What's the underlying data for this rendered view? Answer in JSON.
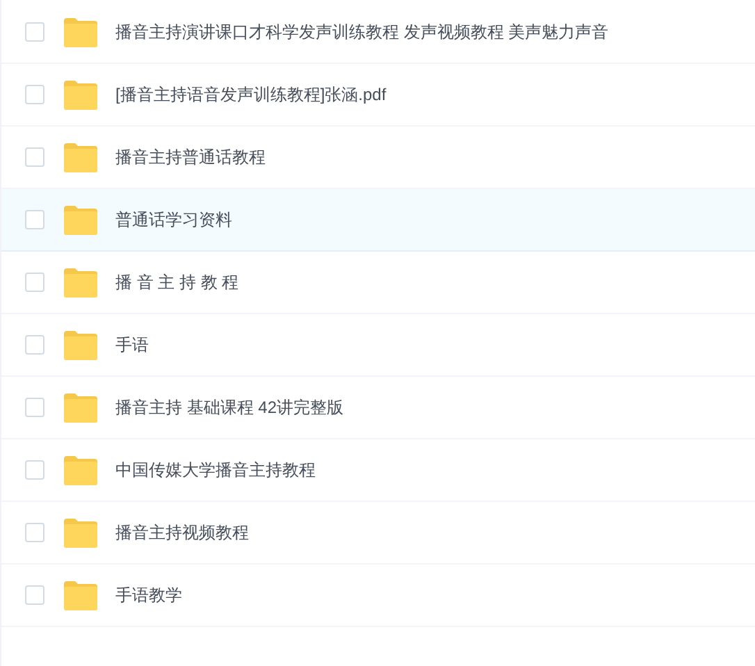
{
  "files": [
    {
      "name": "播音主持演讲课口才科学发声训练教程 发声视频教程 美声魅力声音",
      "checked": false,
      "hovered": false
    },
    {
      "name": "[播音主持语音发声训练教程]张涵.pdf",
      "checked": false,
      "hovered": false
    },
    {
      "name": "播音主持普通话教程",
      "checked": false,
      "hovered": false
    },
    {
      "name": "普通话学习资料",
      "checked": false,
      "hovered": true
    },
    {
      "name": "播 音 主 持 教 程",
      "checked": false,
      "hovered": false
    },
    {
      "name": "手语",
      "checked": false,
      "hovered": false
    },
    {
      "name": "播音主持 基础课程 42讲完整版",
      "checked": false,
      "hovered": false
    },
    {
      "name": "中国传媒大学播音主持教程",
      "checked": false,
      "hovered": false
    },
    {
      "name": "播音主持视频教程",
      "checked": false,
      "hovered": false
    },
    {
      "name": "手语教学",
      "checked": false,
      "hovered": false
    }
  ]
}
